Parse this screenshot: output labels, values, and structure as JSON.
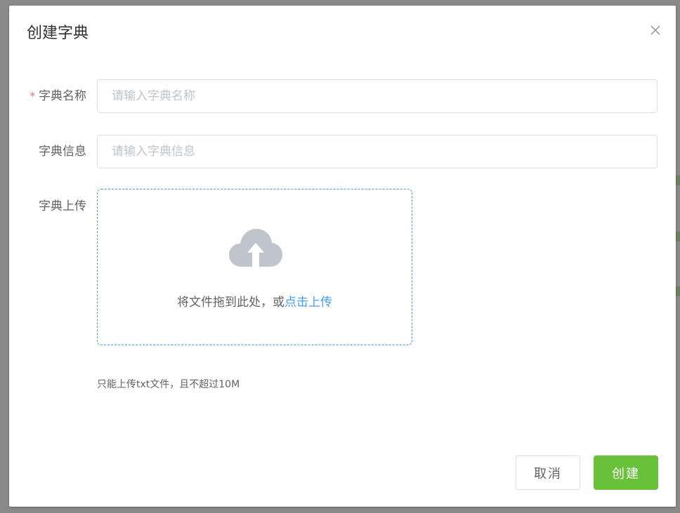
{
  "dialog": {
    "title": "创建字典",
    "close_icon": "close-icon"
  },
  "form": {
    "name": {
      "label": "字典名称",
      "required_mark": "*",
      "placeholder": "请输入字典名称",
      "value": ""
    },
    "info": {
      "label": "字典信息",
      "placeholder": "请输入字典信息",
      "value": ""
    },
    "upload": {
      "label": "字典上传",
      "icon": "cloud-upload-icon",
      "drag_text": "将文件拖到此处，或",
      "link_text": "点击上传",
      "tip": "只能上传txt文件，且不超过10M"
    }
  },
  "footer": {
    "cancel_label": "取消",
    "create_label": "创建"
  },
  "colors": {
    "primary": "#409eff",
    "success": "#67c23a",
    "danger": "#f56c6c",
    "icon_gray": "#c0c4cc"
  }
}
